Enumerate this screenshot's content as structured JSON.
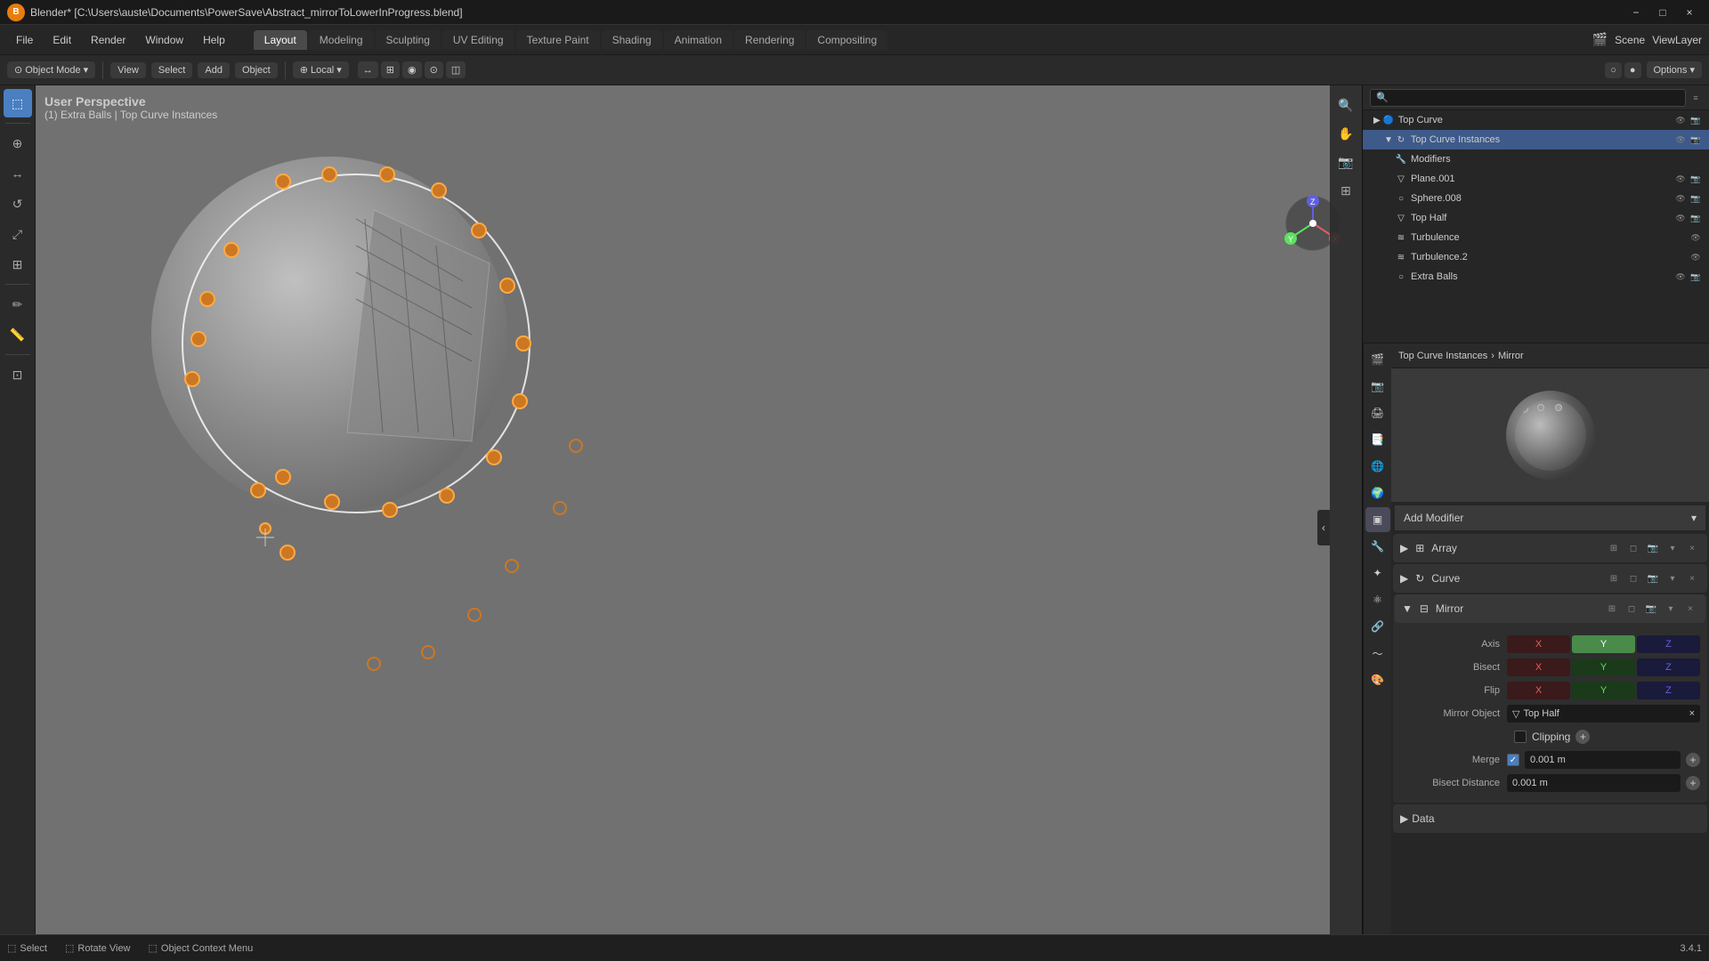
{
  "titlebar": {
    "title": "Blender* [C:\\Users\\auste\\Documents\\PowerSave\\Abstract_mirrorToLowerInProgress.blend]",
    "blender_label": "B",
    "minimize": "−",
    "maximize": "□",
    "close": "×"
  },
  "menubar": {
    "items": [
      "File",
      "Edit",
      "Render",
      "Window",
      "Help"
    ],
    "workspaces": [
      "Layout",
      "Modeling",
      "Sculpting",
      "UV Editing",
      "Texture Paint",
      "Shading",
      "Animation",
      "Rendering",
      "Compositing"
    ]
  },
  "header": {
    "mode_label": "Object Mode",
    "view_label": "View",
    "select_label": "Select",
    "add_label": "Add",
    "object_label": "Object",
    "transform_label": "Local",
    "options_label": "Options ▾"
  },
  "viewport": {
    "view_type": "User Perspective",
    "info": "(1) Extra Balls | Top Curve Instances"
  },
  "outliner": {
    "search_placeholder": "🔍",
    "items": [
      {
        "name": "Top Curve",
        "indent": 0,
        "icon": "↻",
        "level": 1,
        "has_eye": true,
        "has_render": true
      },
      {
        "name": "Top Curve Instances",
        "indent": 1,
        "icon": "↻",
        "level": 2,
        "has_eye": true,
        "has_render": true,
        "selected": true
      },
      {
        "name": "Modifiers",
        "indent": 2,
        "icon": "🔧",
        "level": 3,
        "has_eye": false,
        "has_render": false
      },
      {
        "name": "Plane.001",
        "indent": 2,
        "icon": "▽",
        "level": 3,
        "has_eye": false,
        "has_render": false
      },
      {
        "name": "Sphere.008",
        "indent": 2,
        "icon": "○",
        "level": 3,
        "has_eye": true,
        "has_render": true
      },
      {
        "name": "Top Half",
        "indent": 2,
        "icon": "▽",
        "level": 3,
        "has_eye": true,
        "has_render": true
      },
      {
        "name": "Turbulence",
        "indent": 2,
        "icon": "≋",
        "level": 3,
        "has_eye": false,
        "has_render": false
      },
      {
        "name": "Turbulence.2",
        "indent": 2,
        "icon": "≋",
        "level": 3,
        "has_eye": false,
        "has_render": false
      },
      {
        "name": "Extra Balls",
        "indent": 2,
        "icon": "○",
        "level": 3,
        "has_eye": true,
        "has_render": true
      }
    ]
  },
  "properties": {
    "breadcrumb_object": "Top Curve Instances",
    "breadcrumb_modifier": "Mirror",
    "add_modifier_label": "Add Modifier",
    "modifiers": [
      {
        "name": "Array",
        "icon": "⊞"
      },
      {
        "name": "Curve",
        "icon": "↻"
      },
      {
        "name": "Mirror",
        "icon": "⊟",
        "expanded": true
      }
    ],
    "mirror": {
      "axis_label": "Axis",
      "axis_x": "X",
      "axis_y": "Y",
      "axis_z": "Z",
      "axis_y_active": true,
      "bisect_label": "Bisect",
      "bisect_x": "X",
      "bisect_y": "Y",
      "bisect_z": "Z",
      "flip_label": "Flip",
      "flip_x": "X",
      "flip_y": "Y",
      "flip_z": "Z",
      "mirror_object_label": "Mirror Object",
      "mirror_object_value": "Top Half",
      "clipping_label": "Clipping",
      "clipping_checked": false,
      "merge_label": "Merge",
      "merge_checked": true,
      "merge_value": "0.001 m",
      "bisect_distance_label": "Bisect Distance",
      "bisect_distance_value": "0.001 m",
      "data_label": "Data"
    }
  },
  "bottom_bar": {
    "select_label": "Select",
    "rotate_label": "Rotate View",
    "context_label": "Object Context Menu",
    "version": "3.4.1"
  },
  "scene_icon": "🎬",
  "viewlayer_label": "ViewLayer",
  "scene_label": "Scene",
  "colors": {
    "accent_blue": "#4a7fc1",
    "accent_orange": "#e87d0d",
    "axis_x": "#e06060",
    "axis_y": "#60e060",
    "axis_z": "#6060e0",
    "bg_dark": "#1a1a1a",
    "bg_medium": "#2a2a2a",
    "bg_light": "#3a3a3a",
    "viewport_bg": "#717171",
    "selected": "#3d5a8a"
  }
}
